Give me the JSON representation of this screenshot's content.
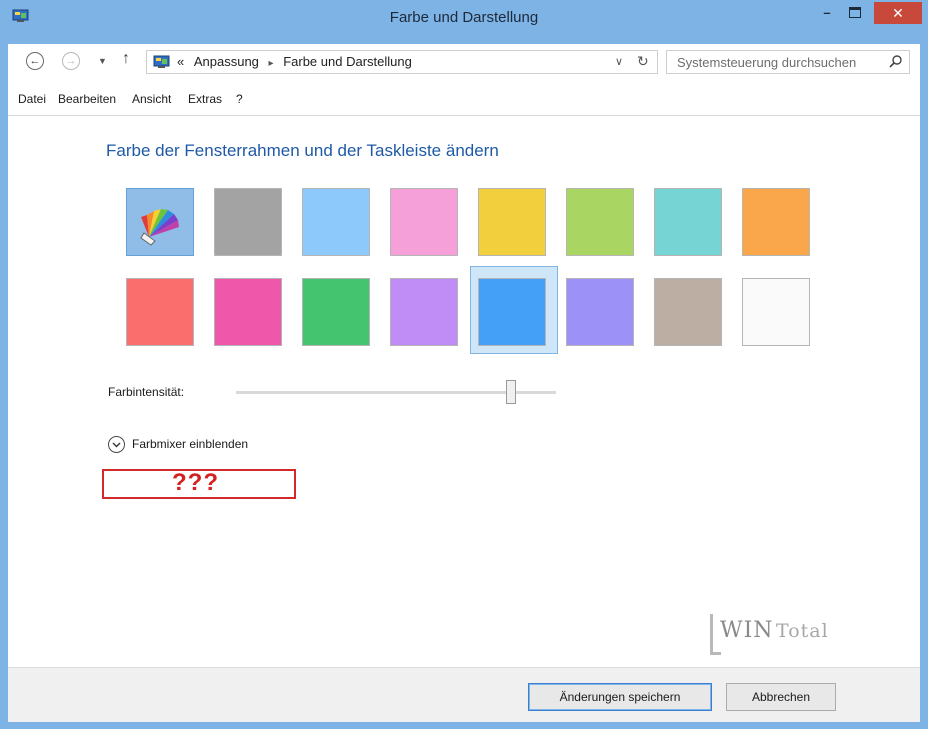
{
  "window": {
    "title": "Farbe und Darstellung",
    "minimize_glyph": "–",
    "close_glyph": "✕"
  },
  "address_bar": {
    "back_glyph": "←",
    "forward_glyph": "→",
    "dropdown_glyph": "▼",
    "up_glyph": "↑",
    "overflow": "«",
    "breadcrumbs": [
      "Anpassung",
      "Farbe und Darstellung"
    ],
    "crumb_separator": "▸",
    "dropdown_chevron": "∨",
    "refresh_glyph": "↻",
    "search_placeholder": "Systemsteuerung durchsuchen"
  },
  "menu": {
    "items": [
      "Datei",
      "Bearbeiten",
      "Ansicht",
      "Extras",
      "?"
    ]
  },
  "main": {
    "heading": "Farbe der Fensterrahmen und der Taskleiste ändern",
    "color_swatches_row1": [
      "automatic",
      "#a3a3a3",
      "#8ec9fb",
      "#f5a0d8",
      "#f2d03d",
      "#a9d663",
      "#76d4d4",
      "#faa64a"
    ],
    "color_swatches_row2": [
      "#fa6e6e",
      "#ef57ab",
      "#45c46f",
      "#c08df6",
      "#449ff7",
      "#9b91f7",
      "#bcaea2",
      "#fafafa"
    ],
    "selected_swatch": "#449ff7",
    "intensity_label": "Farbintensität:",
    "intensity_level": 0.86,
    "mixer_label": "Farbmixer einblenden",
    "annotation": "???"
  },
  "watermark": {
    "part1": "WIN",
    "part2": "Total"
  },
  "footer": {
    "save_label": "Änderungen speichern",
    "cancel_label": "Abbrechen"
  },
  "icons": {
    "app": "control-panel-icon",
    "color_picker": "rainbow-fan-icon",
    "search": "search-icon",
    "expand": "chevron-down-icon"
  }
}
